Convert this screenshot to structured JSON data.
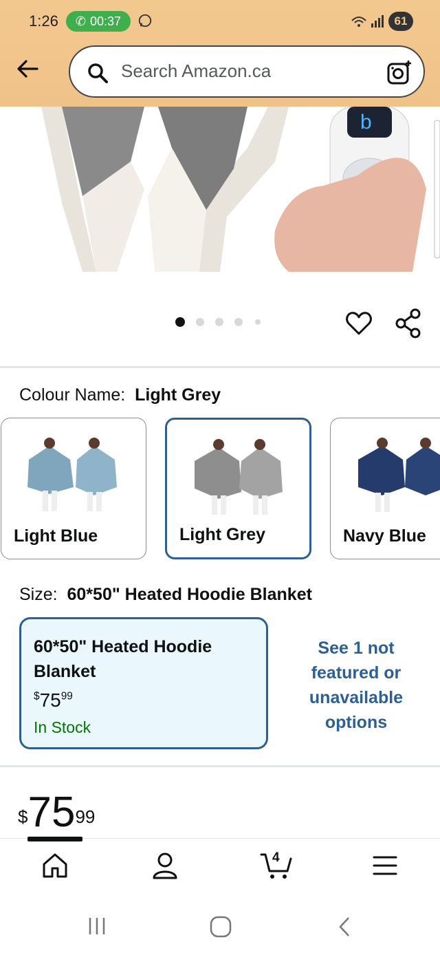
{
  "status_bar": {
    "time": "1:26",
    "call_timer": "00:37",
    "battery": "61"
  },
  "search": {
    "placeholder": "Search Amazon.ca"
  },
  "gallery": {
    "dot_count": 5,
    "active_dot": 0
  },
  "colour": {
    "label": "Colour Name:",
    "selected": "Light Grey",
    "options": [
      {
        "name": "Light Blue",
        "color": "#7fa6bd"
      },
      {
        "name": "Light Grey",
        "color": "#8e8e8e"
      },
      {
        "name": "Navy Blue",
        "color": "#243b6b"
      }
    ]
  },
  "size": {
    "label": "Size:",
    "selected": "60*50\" Heated Hoodie Blanket",
    "card": {
      "title": "60*50\" Heated Hoodie Blanket",
      "price_dollars": "75",
      "price_cents": "99",
      "currency": "$",
      "stock": "In Stock"
    },
    "more_options": "See 1 not featured or unavailable options"
  },
  "price": {
    "currency": "$",
    "dollars": "75",
    "cents": "99"
  },
  "nav": {
    "cart_count": "4"
  },
  "colors": {
    "accent_blue": "#2d5f94",
    "header_bg": "#f3c88f",
    "stock_green": "#007600"
  }
}
